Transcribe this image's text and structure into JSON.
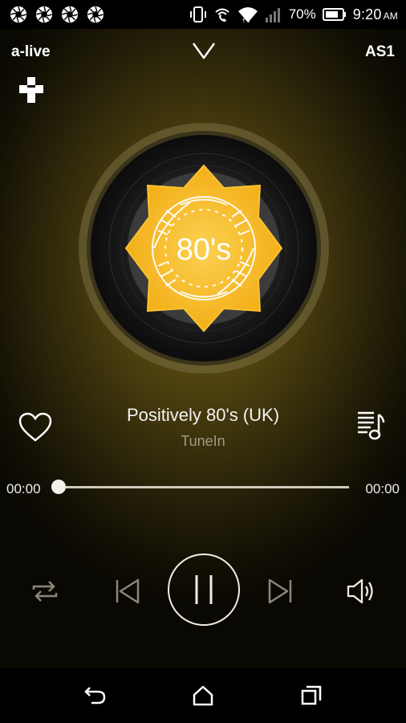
{
  "status_bar": {
    "battery_percent": "70%",
    "time": "9:20",
    "time_suffix": "AM",
    "notification_icons": [
      "aperture-icon",
      "aperture-icon",
      "aperture-icon",
      "aperture-icon"
    ]
  },
  "header": {
    "left_label": "a-live",
    "right_label": "AS1",
    "collapse_icon": "chevron-down-icon",
    "provider_logo": "tunein-logo-icon"
  },
  "album_art": {
    "label": "80's",
    "colors": {
      "badge": "#f5b418",
      "badge_inner": "#f9c52e",
      "disc": "#1b1b1b",
      "ring": "#8b7e57"
    }
  },
  "track": {
    "title": "Positively 80's (UK)",
    "source": "TuneIn",
    "position": "00:00",
    "duration": "00:00",
    "progress_fraction": 0
  },
  "controls": {
    "icons": [
      "repeat-icon",
      "previous-icon",
      "pause-icon",
      "next-icon",
      "volume-icon"
    ],
    "favorite_icon": "heart-icon",
    "queue_icon": "playlist-icon"
  },
  "nav_bar": {
    "icons": [
      "back-icon",
      "home-icon",
      "recents-icon"
    ]
  }
}
